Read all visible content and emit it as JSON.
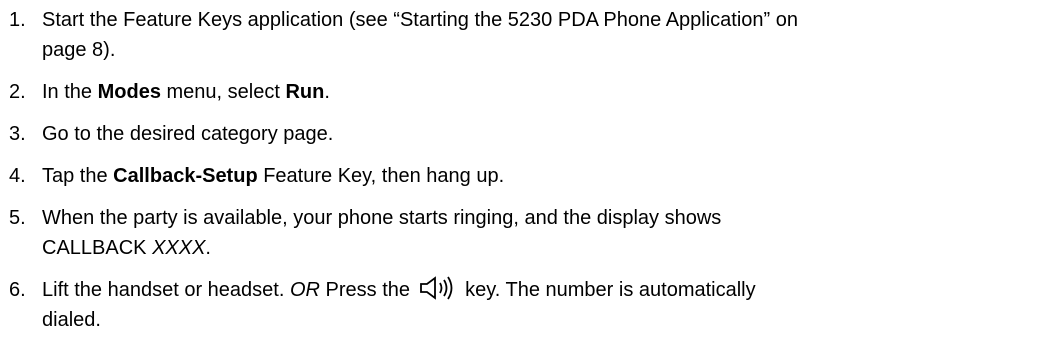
{
  "steps": [
    {
      "number": "1.",
      "line1": "Start the Feature Keys application (see “Starting the 5230 PDA Phone Application” on",
      "line2": "page 8)."
    },
    {
      "number": "2.",
      "pre": "In the ",
      "bold1": "Modes",
      "mid": " menu, select ",
      "bold2": "Run",
      "post": "."
    },
    {
      "number": "3.",
      "text": "Go to the desired category page."
    },
    {
      "number": "4.",
      "pre": "Tap the ",
      "bold1": "Callback-Setup",
      "post": " Feature Key, then hang up."
    },
    {
      "number": "5.",
      "line1": "When the party is available, your phone starts ringing, and the display shows",
      "line2_pre": "CALLBACK ",
      "line2_ital": "XXXX",
      "line2_post": "."
    },
    {
      "number": "6.",
      "pre": "Lift the handset or headset.  ",
      "ital": "OR",
      "mid": " Press the ",
      "icon": "speaker-icon",
      "post": " key. The number is automatically",
      "line2": "dialed."
    }
  ]
}
